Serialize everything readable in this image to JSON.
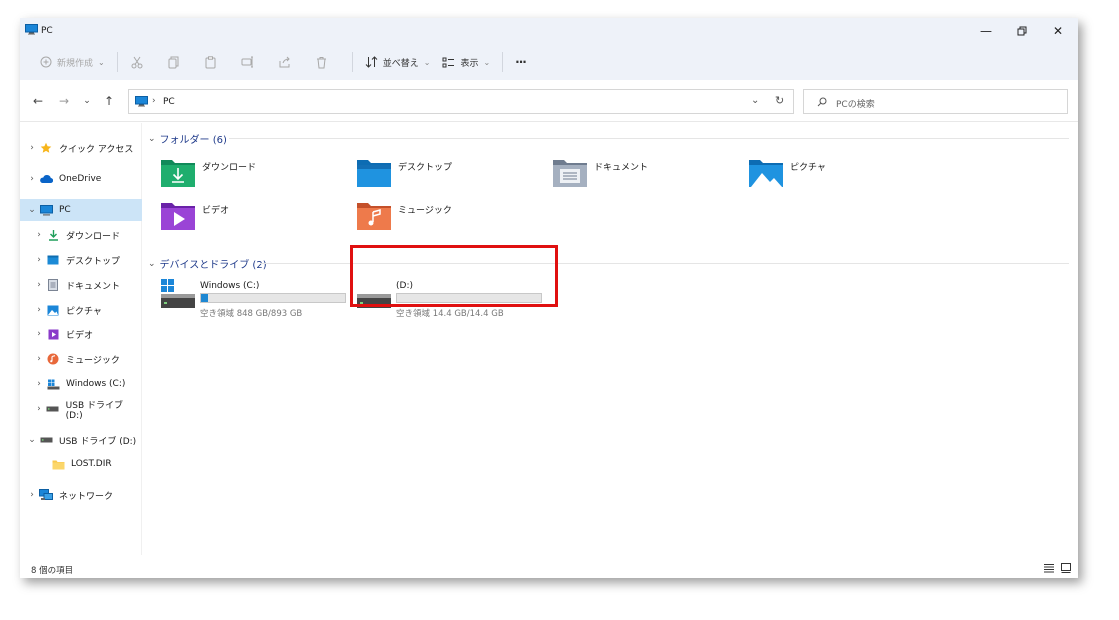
{
  "window": {
    "title": "PC"
  },
  "toolbar": {
    "new_label": "新規作成",
    "sort_label": "並べ替え",
    "view_label": "表示",
    "more_label": "···"
  },
  "address": {
    "path": "PC",
    "search_placeholder": "PCの検索"
  },
  "sidebar": {
    "items": [
      {
        "label": "クイック アクセス",
        "icon": "star-icon",
        "chevron": "›"
      },
      {
        "label": "OneDrive",
        "icon": "cloud-icon",
        "chevron": "›"
      },
      {
        "label": "PC",
        "icon": "monitor-icon",
        "chevron": "⌄"
      },
      {
        "label": "ダウンロード",
        "icon": "download-icon",
        "chevron": "›"
      },
      {
        "label": "デスクトップ",
        "icon": "desktop-icon",
        "chevron": "›"
      },
      {
        "label": "ドキュメント",
        "icon": "document-icon",
        "chevron": "›"
      },
      {
        "label": "ピクチャ",
        "icon": "picture-icon",
        "chevron": "›"
      },
      {
        "label": "ビデオ",
        "icon": "video-icon",
        "chevron": "›"
      },
      {
        "label": "ミュージック",
        "icon": "music-icon",
        "chevron": "›"
      },
      {
        "label": "Windows (C:)",
        "icon": "windows-drive-icon",
        "chevron": "›"
      },
      {
        "label": "USB ドライブ (D:)",
        "icon": "usb-drive-icon",
        "chevron": "›"
      },
      {
        "label": "USB ドライブ (D:)",
        "icon": "usb-drive-icon",
        "chevron": "⌄"
      },
      {
        "label": "LOST.DIR",
        "icon": "folder-icon",
        "chevron": ""
      },
      {
        "label": "ネットワーク",
        "icon": "network-icon",
        "chevron": "›"
      }
    ]
  },
  "main": {
    "folders_header": "フォルダー (6)",
    "folders": [
      {
        "label": "ダウンロード",
        "icon": "downloads-folder-icon"
      },
      {
        "label": "デスクトップ",
        "icon": "desktop-folder-icon"
      },
      {
        "label": "ドキュメント",
        "icon": "documents-folder-icon"
      },
      {
        "label": "ピクチャ",
        "icon": "pictures-folder-icon"
      },
      {
        "label": "ビデオ",
        "icon": "videos-folder-icon"
      },
      {
        "label": "ミュージック",
        "icon": "music-folder-icon"
      }
    ],
    "drives_header": "デバイスとドライブ (2)",
    "drives": [
      {
        "name": "Windows (C:)",
        "free": "空き領域 848 GB/893 GB",
        "used_fraction": 0.05
      },
      {
        "name": "(D:)",
        "free": "空き領域 14.4 GB/14.4 GB",
        "used_fraction": 0.0
      }
    ]
  },
  "status": {
    "item_count": "8 個の項目"
  },
  "colors": {
    "accent": "#1e88d3",
    "highlight": "#e01010",
    "selection": "#cce4f7"
  }
}
